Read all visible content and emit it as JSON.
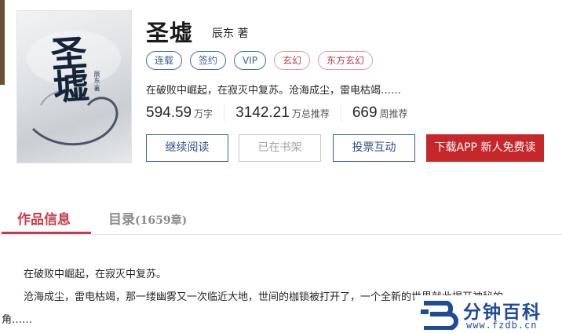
{
  "book": {
    "cover_title": "圣墟",
    "cover_author": "辰东·著",
    "title": "圣墟",
    "author": "辰东 著",
    "tags": [
      "连载",
      "签约",
      "VIP",
      "玄幻",
      "东方玄幻"
    ],
    "intro": "在破败中崛起，在寂灭中复苏。沧海成尘，雷电枯竭……"
  },
  "stats": [
    {
      "value": "594.59",
      "unit": "万字"
    },
    {
      "value": "3142.21",
      "unit": "万总推荐"
    },
    {
      "value": "669",
      "unit": "周推荐"
    }
  ],
  "actions": {
    "continue": "继续阅读",
    "shelf": "已在书架",
    "vote": "投票互动",
    "download": "下载APP 新人免费读"
  },
  "tabs": {
    "info": "作品信息",
    "catalog": "目录",
    "catalog_count": "(1659章)"
  },
  "description": {
    "p1": "在破败中崛起，在寂灭中复苏。",
    "p2": "沧海成尘，雷电枯竭，那一缕幽雾又一次临近大地，世间的枷锁被打开了，一个全新的世界就此揭开神秘的一",
    "p3": "角……"
  },
  "watermark": {
    "name": "分钟百科",
    "url": "www.fzdb.cn"
  },
  "colors": {
    "brand_blue": "#3e5f98",
    "accent_red": "#c5272b",
    "tab_active": "#c73a4a"
  }
}
